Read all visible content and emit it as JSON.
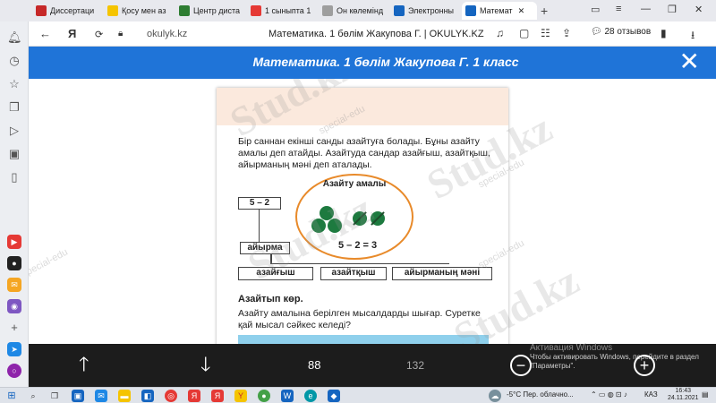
{
  "tabs": [
    {
      "label": "Диссертаци",
      "color": "#c62828"
    },
    {
      "label": "Қосу мен аз",
      "color": "#f5c400"
    },
    {
      "label": "Центр диста",
      "color": "#2e7d32"
    },
    {
      "label": "1 сыныпта 1",
      "color": "#e53935"
    },
    {
      "label": "Он көлемінд",
      "color": "#9e9e9e"
    },
    {
      "label": "Электронны",
      "color": "#1565c0"
    },
    {
      "label": "Математ",
      "color": "#1565c0",
      "active": true
    }
  ],
  "window": {
    "minimize": "—",
    "maximize": "❐",
    "close": "✕",
    "menu": "≡",
    "profile": "▭"
  },
  "address_bar": {
    "back": "←",
    "yandex": "Я",
    "url": "okulyk.kz",
    "page_title": "Математика. 1 бөлім Жакупова Г. | OKULYK.KZ",
    "reviews": "28 отзывов"
  },
  "reader": {
    "title": "Математика. 1 бөлім Жакупова Г. 1 класс",
    "close": "✕"
  },
  "book": {
    "paragraph": "Бір саннан екінші санды азайтуға болады. Бұны азайту амалы деп атайды. Азайтуда сандар азайғыш, азайтқыш, айырманың мәні деп аталады.",
    "box_expr": "5 – 2",
    "box_difference": "айырма",
    "oval_label": "Азайту амалы",
    "oval_expr": "5 – 2 = 3",
    "label_minuend": "азайғыш",
    "label_subtrahend": "азайтқыш",
    "label_result": "айырманың мәні",
    "section_title": "Азайтып көр.",
    "task_text": "Азайту амалына берілген мысалдарды шығар. Суретке қай мысал сәйкес келеді?"
  },
  "watermarks": {
    "main": "Stud.kz",
    "sub": "special-edu"
  },
  "toolbar": {
    "up": "🡑",
    "down": "🡓",
    "current_page": "88",
    "total_pages": "132",
    "zoom_out": "−",
    "zoom_in": "+"
  },
  "activation": {
    "title": "Активация Windows",
    "text": "Чтобы активировать Windows, перейдите в раздел \"Параметры\"."
  },
  "taskbar": {
    "weather": "-5°C  Пер. облачно...",
    "lang": "КАЗ",
    "time": "16:43",
    "date": "24.11.2021"
  }
}
